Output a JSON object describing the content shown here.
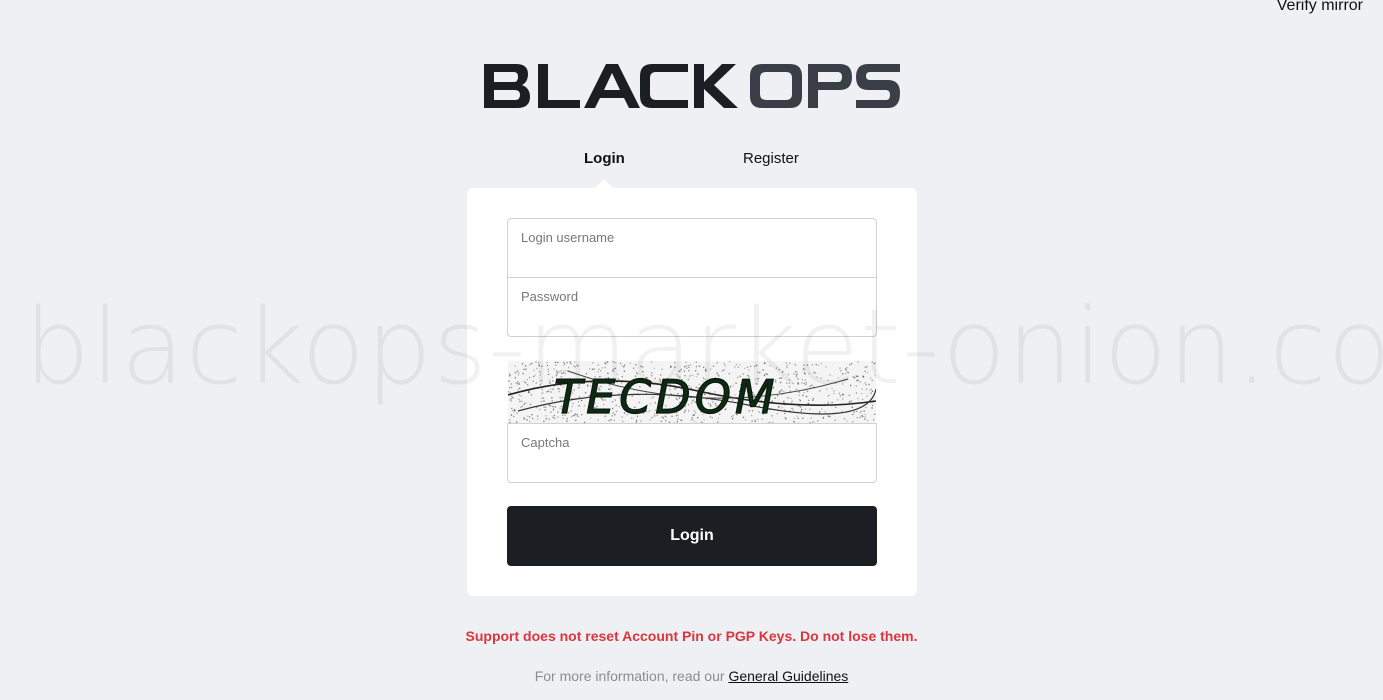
{
  "header": {
    "verify_mirror_label": "Verify mirror",
    "logo_text": "BLACK OPS"
  },
  "tabs": [
    {
      "label": "Login",
      "active": true
    },
    {
      "label": "Register",
      "active": false
    }
  ],
  "form": {
    "username_label": "Login username",
    "username_value": "",
    "password_label": "Password",
    "password_value": "",
    "captcha_text": "TECDOM",
    "captcha_label": "Captcha",
    "captcha_value": "",
    "submit_label": "Login"
  },
  "footer": {
    "warning": "Support does not reset Account Pin or PGP Keys. Do not lose them.",
    "info_prefix": "For more information, read our",
    "guidelines_link": "General Guidelines"
  },
  "watermark": "blackops-market-onion.com",
  "colors": {
    "background": "#eff0f4",
    "card": "#ffffff",
    "button": "#1b1f23",
    "warning": "#d9363e",
    "logo_primary": "#1b1f23",
    "logo_secondary": "#3a3f47"
  }
}
